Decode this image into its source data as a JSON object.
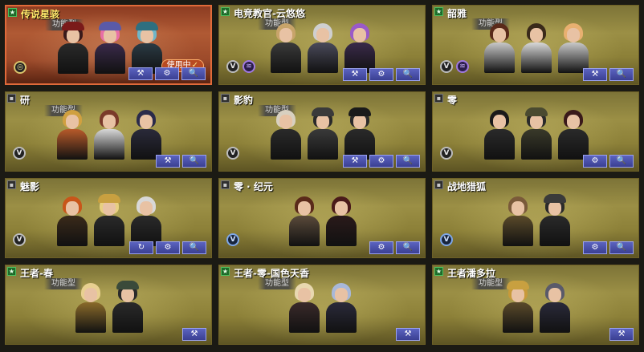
{
  "colors": {
    "card_gold": "#9b8f45",
    "card_selected": "#b05a34",
    "button_blue": "#3a3f92",
    "in_use_orange": "#b84a22"
  },
  "cards": [
    {
      "name": "传说星骇",
      "type_badge": "功能型",
      "in_use": "使用中",
      "selected": true,
      "corner": "star",
      "rank": "ring",
      "perk": false,
      "buttons": [
        "customize",
        "settings",
        "view"
      ],
      "chars": [
        {
          "hair": "#3a1a1a",
          "hat": "#7a1a1a",
          "body": "#2a2a2a"
        },
        {
          "hair": "#e86fa6",
          "hat": "#5a5aa8",
          "body": "#3a2a4a"
        },
        {
          "hair": "#6fb6c8",
          "hat": "#2e6f80",
          "body": "#2a3a44"
        }
      ]
    },
    {
      "name": "电竞教官-云悠悠",
      "type_badge": "功能型",
      "selected": false,
      "corner": "star",
      "rank": "V",
      "perk": true,
      "buttons": [
        "customize",
        "settings",
        "view"
      ],
      "chars": [
        {
          "hair": "#c8a46a",
          "hat": "",
          "body": "#3a3a3a"
        },
        {
          "hair": "#cfcfcf",
          "hat": "",
          "body": "#4a4a5a"
        },
        {
          "hair": "#9a5ac8",
          "hat": "",
          "body": "#3a2a4a"
        }
      ]
    },
    {
      "name": "韶雅",
      "type_badge": "功能型",
      "selected": false,
      "corner": "star",
      "rank": "V",
      "perk": true,
      "buttons": [
        "customize",
        "view"
      ],
      "chars": [
        {
          "hair": "#5a2a1a",
          "hat": "",
          "body": "#c8c8c8"
        },
        {
          "hair": "#3a2a1a",
          "hat": "",
          "body": "#d8d8d8"
        },
        {
          "hair": "#e8b070",
          "hat": "",
          "body": "#c8c8c8"
        }
      ]
    },
    {
      "name": "研",
      "type_badge": "功能型",
      "selected": false,
      "corner": "box",
      "rank": "V",
      "perk": false,
      "buttons": [
        "customize",
        "view"
      ],
      "chars": [
        {
          "hair": "#d0a040",
          "hat": "",
          "body": "#b85a2a"
        },
        {
          "hair": "#7a3a2a",
          "hat": "",
          "body": "#d8d8d8"
        },
        {
          "hair": "#2a2a4a",
          "hat": "",
          "body": "#2a2a3a"
        }
      ]
    },
    {
      "name": "影豹",
      "type_badge": "功能型",
      "selected": false,
      "corner": "box",
      "rank": "V",
      "perk": false,
      "buttons": [
        "customize",
        "settings",
        "view"
      ],
      "chars": [
        {
          "hair": "#d8d0c0",
          "hat": "",
          "body": "#2a2a2a"
        },
        {
          "hair": "#2a2a2a",
          "hat": "#3a3a3a",
          "body": "#3a3a3a"
        },
        {
          "hair": "#2a2a2a",
          "hat": "#1a1a1a",
          "body": "#2a2a2a"
        }
      ]
    },
    {
      "name": "零",
      "type_badge": "",
      "selected": false,
      "corner": "box",
      "rank": "V",
      "perk": false,
      "buttons": [
        "settings",
        "view"
      ],
      "chars": [
        {
          "hair": "#1a1a1a",
          "hat": "",
          "body": "#2a2a2a"
        },
        {
          "hair": "#2a2a2a",
          "hat": "#4a4a30",
          "body": "#3a3a2a"
        },
        {
          "hair": "#3a1a1a",
          "hat": "",
          "body": "#2a2a2a"
        }
      ]
    },
    {
      "name": "魅影",
      "type_badge": "",
      "selected": false,
      "corner": "box",
      "rank": "V",
      "perk": false,
      "buttons": [
        "refresh",
        "settings",
        "view"
      ],
      "chars": [
        {
          "hair": "#c8561a",
          "hat": "",
          "body": "#3a2a1a"
        },
        {
          "hair": "#e8d080",
          "hat": "#c8a040",
          "body": "#2a2a2a"
        },
        {
          "hair": "#d8d8d8",
          "hat": "",
          "body": "#2a2a2a"
        }
      ]
    },
    {
      "name": "零 · 纪元",
      "type_badge": "",
      "selected": false,
      "corner": "box",
      "rank": "blue",
      "perk": false,
      "buttons": [
        "settings",
        "view"
      ],
      "chars": [
        {
          "hair": "#5a2a1a",
          "hat": "",
          "body": "#5a4a3a"
        },
        {
          "hair": "#4a1a1a",
          "hat": "",
          "body": "#2a1a1a"
        }
      ]
    },
    {
      "name": "战地猎狐",
      "type_badge": "",
      "selected": false,
      "corner": "box",
      "rank": "blue",
      "perk": false,
      "buttons": [
        "settings",
        "view"
      ],
      "chars": [
        {
          "hair": "#7a5a3a",
          "hat": "",
          "body": "#5a4a2a"
        },
        {
          "hair": "#2a2a2a",
          "hat": "#3a3a3a",
          "body": "#2a2a2a"
        }
      ]
    },
    {
      "name": "王者-春",
      "type_badge": "功能型",
      "selected": false,
      "corner": "star",
      "rank": "",
      "perk": false,
      "buttons": [
        "customize"
      ],
      "chars": [
        {
          "hair": "#e8d090",
          "hat": "",
          "body": "#8a6a2a"
        },
        {
          "hair": "#2a2a2a",
          "hat": "#3a4a3a",
          "body": "#2a2a2a"
        }
      ]
    },
    {
      "name": "王者-零-国色天香",
      "type_badge": "功能型",
      "selected": false,
      "corner": "star",
      "rank": "",
      "perk": false,
      "buttons": [
        "customize"
      ],
      "chars": [
        {
          "hair": "#e8d8b0",
          "hat": "",
          "body": "#3a2a2a"
        },
        {
          "hair": "#a8b8d8",
          "hat": "",
          "body": "#2a2a3a"
        }
      ]
    },
    {
      "name": "王者潘多拉",
      "type_badge": "功能型",
      "selected": false,
      "corner": "star",
      "rank": "",
      "perk": false,
      "buttons": [
        "customize"
      ],
      "chars": [
        {
          "hair": "#c89a3a",
          "hat": "#c8a040",
          "body": "#5a4a2a"
        },
        {
          "hair": "#5a5a6a",
          "hat": "",
          "body": "#2a2a3a"
        }
      ]
    }
  ],
  "icons": {
    "customize": "⚒",
    "settings": "⚙",
    "view": "🔍",
    "refresh": "↻",
    "star": "★",
    "box": "▪",
    "rank_v": "V",
    "rank_ring": "◎",
    "perk": "≋",
    "check": "✓"
  }
}
